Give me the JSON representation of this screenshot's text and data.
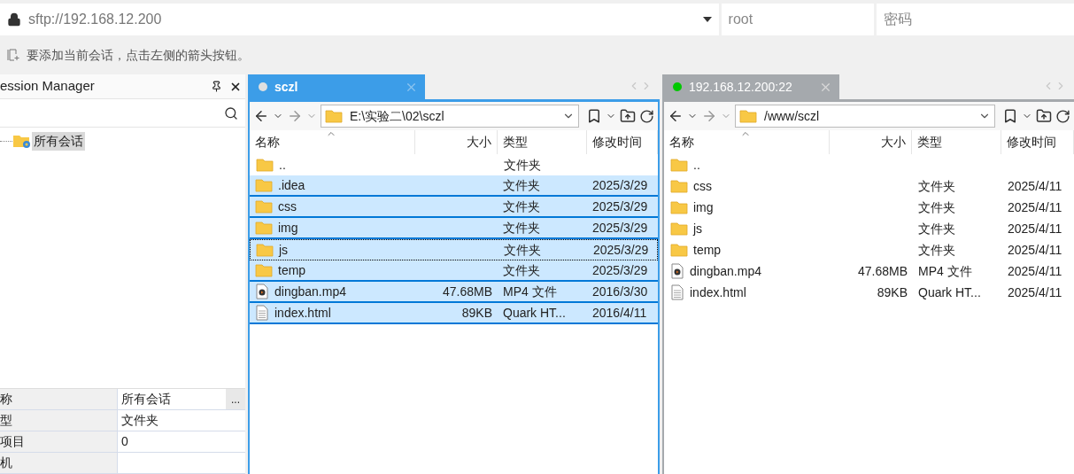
{
  "connection": {
    "address": "sftp://192.168.12.200",
    "user": "root",
    "password_placeholder": "密码"
  },
  "hint": "要添加当前会话，点击左侧的箭头按钮。",
  "session_manager": {
    "title": "ession Manager",
    "tree": [
      {
        "label": "所有会话",
        "selected": true
      }
    ],
    "properties": [
      {
        "name": "称",
        "value": "所有会话",
        "kind": "edit",
        "button": "..."
      },
      {
        "name": "型",
        "value": "文件夹",
        "kind": "text"
      },
      {
        "name": "项目",
        "value": "0",
        "kind": "text"
      },
      {
        "name": "机",
        "kind": "text"
      }
    ]
  },
  "panes": [
    {
      "tab": {
        "label": "sczl",
        "color": "#e0e0e0",
        "selected": true
      },
      "path": "E:\\实验二\\02\\sczl",
      "columns": [
        "名称",
        "大小",
        "类型",
        "修改时间"
      ],
      "rows": [
        {
          "name": "..",
          "type": "文件夹",
          "kind": "folder",
          "selected": false,
          "focused": false
        },
        {
          "name": ".idea",
          "type": "文件夹",
          "modified": "2025/3/29",
          "kind": "folder",
          "selected": true,
          "focused": false
        },
        {
          "name": "css",
          "type": "文件夹",
          "modified": "2025/3/29",
          "kind": "folder",
          "selected": true,
          "focused": false
        },
        {
          "name": "img",
          "type": "文件夹",
          "modified": "2025/3/29",
          "kind": "folder",
          "selected": true,
          "focused": false
        },
        {
          "name": "js",
          "type": "文件夹",
          "modified": "2025/3/29",
          "kind": "folder",
          "selected": true,
          "focused": true
        },
        {
          "name": "temp",
          "type": "文件夹",
          "modified": "2025/3/29",
          "kind": "folder",
          "selected": true,
          "focused": false
        },
        {
          "name": "dingban.mp4",
          "size": "47.68MB",
          "type": "MP4 文件",
          "modified": "2016/3/30",
          "kind": "video",
          "selected": true,
          "focused": false
        },
        {
          "name": "index.html",
          "size": "89KB",
          "type": "Quark HT...",
          "modified": "2016/4/11",
          "kind": "file",
          "selected": true,
          "focused": false
        }
      ]
    },
    {
      "tab": {
        "label": "192.168.12.200:22",
        "color": "#00c800",
        "selected": false
      },
      "path": "/www/sczl",
      "columns": [
        "名称",
        "大小",
        "类型",
        "修改时间"
      ],
      "rows": [
        {
          "name": "..",
          "kind": "folder",
          "selected": false,
          "focused": false
        },
        {
          "name": "css",
          "type": "文件夹",
          "modified": "2025/4/11",
          "kind": "folder",
          "selected": false,
          "focused": false
        },
        {
          "name": "img",
          "type": "文件夹",
          "modified": "2025/4/11",
          "kind": "folder",
          "selected": false,
          "focused": false
        },
        {
          "name": "js",
          "type": "文件夹",
          "modified": "2025/4/11",
          "kind": "folder",
          "selected": false,
          "focused": false
        },
        {
          "name": "temp",
          "type": "文件夹",
          "modified": "2025/4/11",
          "kind": "folder",
          "selected": false,
          "focused": false
        },
        {
          "name": "dingban.mp4",
          "size": "47.68MB",
          "type": "MP4 文件",
          "modified": "2025/4/11",
          "kind": "video",
          "selected": false,
          "focused": false
        },
        {
          "name": "index.html",
          "size": "89KB",
          "type": "Quark HT...",
          "modified": "2025/4/11",
          "kind": "file",
          "selected": false,
          "focused": false
        }
      ]
    }
  ]
}
